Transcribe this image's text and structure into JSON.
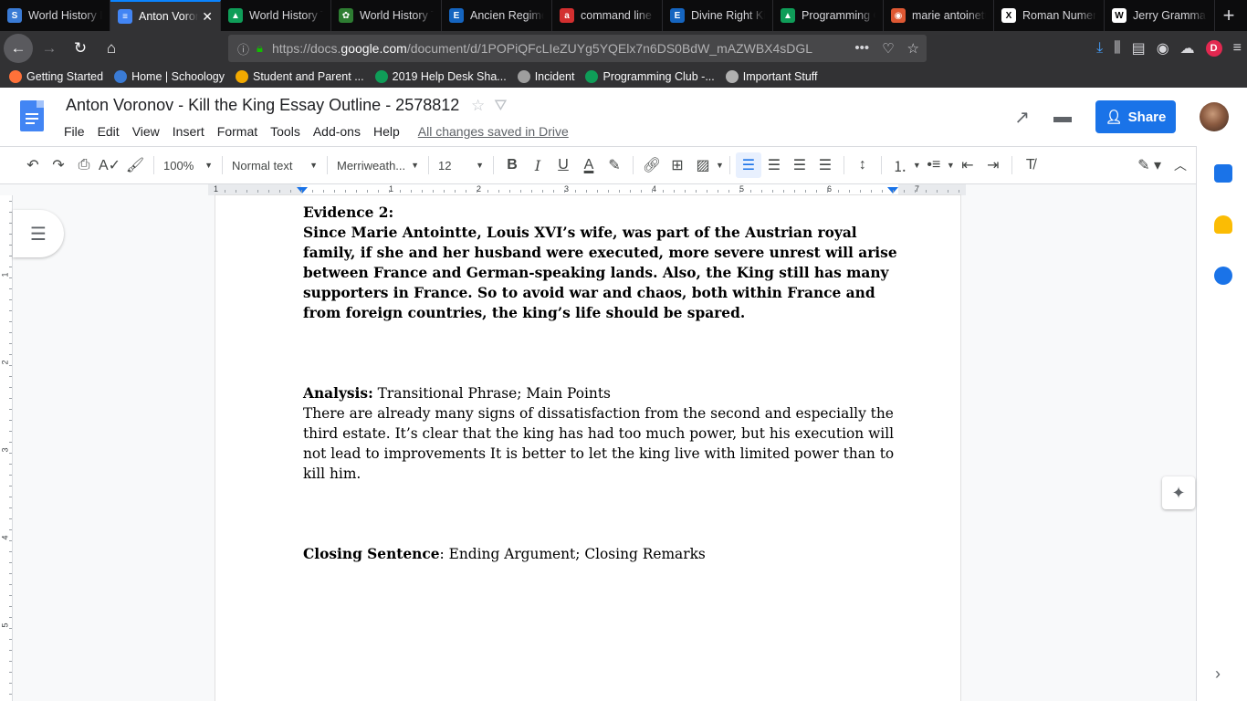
{
  "browser": {
    "tabs": [
      {
        "title": "World History I",
        "icon": "schoology-icon",
        "color": "#3a7bd5",
        "glyph": "S"
      },
      {
        "title": "Anton Voronov",
        "icon": "google-docs-icon",
        "color": "#4285f4",
        "glyph": "≡",
        "active": true
      },
      {
        "title": "World History T",
        "icon": "google-drive-icon",
        "color": "#0f9d58",
        "glyph": "▲"
      },
      {
        "title": "World History T",
        "icon": "leaf-icon",
        "color": "#2e7d32",
        "glyph": "✿"
      },
      {
        "title": "Ancien Regime",
        "icon": "britannica-icon",
        "color": "#1565c0",
        "glyph": "E"
      },
      {
        "title": "command line",
        "icon": "ask-icon",
        "color": "#d32f2f",
        "glyph": "a"
      },
      {
        "title": "Divine Right Ki",
        "icon": "britannica-icon",
        "color": "#1565c0",
        "glyph": "E"
      },
      {
        "title": "Programming C",
        "icon": "google-drive-icon",
        "color": "#0f9d58",
        "glyph": "▲"
      },
      {
        "title": "marie antoinett",
        "icon": "duckduckgo-icon",
        "color": "#de5833",
        "glyph": "◉"
      },
      {
        "title": "Roman Numera",
        "icon": "x-icon",
        "color": "#ffffff",
        "glyph": "X"
      },
      {
        "title": "Jerry Grammar",
        "icon": "wikipedia-icon",
        "color": "#ffffff",
        "glyph": "W"
      }
    ],
    "url_prefix": "https://docs.",
    "url_host": "google.com",
    "url_path": "/document/d/1POPiQFcLIeZUYg5YQElx7n6DS0BdW_mAZWBX4sDGL",
    "profile_letter": "D",
    "bookmarks": [
      {
        "label": "Getting Started",
        "icon": "firefox-icon",
        "color": "#ff7139"
      },
      {
        "label": "Home | Schoology",
        "icon": "schoology-icon",
        "color": "#3a7bd5"
      },
      {
        "label": "Student and Parent ...",
        "icon": "p-icon",
        "color": "#f2a900"
      },
      {
        "label": "2019 Help Desk Sha...",
        "icon": "google-drive-icon",
        "color": "#0f9d58"
      },
      {
        "label": "Incident",
        "icon": "globe-icon",
        "color": "#9e9e9e"
      },
      {
        "label": "Programming Club -...",
        "icon": "google-drive-icon",
        "color": "#0f9d58"
      },
      {
        "label": "Important Stuff",
        "icon": "folder-icon",
        "color": "#b0b0b0"
      }
    ]
  },
  "docs": {
    "title": "Anton Voronov - Kill the King Essay Outline - 2578812",
    "menu": [
      "File",
      "Edit",
      "View",
      "Insert",
      "Format",
      "Tools",
      "Add-ons",
      "Help"
    ],
    "saved_status": "All changes saved in Drive",
    "share_label": "Share",
    "toolbar": {
      "zoom": "100%",
      "style": "Normal text",
      "font": "Merriweath...",
      "size": "12"
    },
    "ruler_numbers": [
      "1",
      "1",
      "2",
      "3",
      "4",
      "5",
      "6",
      "7"
    ],
    "vruler_numbers": [
      "1",
      "2",
      "3",
      "4",
      "5"
    ]
  },
  "document": {
    "evidence_heading": "Evidence 2:",
    "evidence_text": "Since Marie Antointte, Louis XVI’s wife,  was part of the Austrian royal family, if she and her husband were executed, more severe unrest will arise between France and German-speaking lands. Also, the King still has many supporters in France. So to avoid war and chaos, both within France and from foreign countries, the king’s life should be spared.",
    "analysis_label": "Analysis:",
    "analysis_hint": " Transitional Phrase; Main Points",
    "analysis_text": "There are already many signs of dissatisfaction from the second and especially the third estate. It’s clear that the king has had too much power, but his execution will not lead to improvements It is better to let the king live with limited power than to kill him.",
    "closing_label": "Closing Sentence",
    "closing_hint": ": Ending Argument; Closing Remarks"
  }
}
